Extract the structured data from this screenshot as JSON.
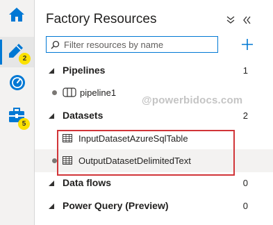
{
  "rail": {
    "items": [
      {
        "name": "home",
        "icon": "home-icon",
        "badge": ""
      },
      {
        "name": "author",
        "icon": "pencil-icon",
        "badge": "2"
      },
      {
        "name": "monitor",
        "icon": "monitor-gauge-icon",
        "badge": ""
      },
      {
        "name": "manage",
        "icon": "toolbox-icon",
        "badge": "5"
      }
    ]
  },
  "panel": {
    "title": "Factory Resources",
    "collapse_all_icon": "collapse-all-icon",
    "hide_panel_icon": "double-chevron-left-icon",
    "filter": {
      "placeholder": "Filter resources by name",
      "value": ""
    },
    "add_icon": "plus-icon",
    "sections": [
      {
        "label": "Pipelines",
        "count": "1",
        "items": [
          {
            "label": "pipeline1",
            "icon": "pipeline-icon"
          }
        ]
      },
      {
        "label": "Datasets",
        "count": "2",
        "items": [
          {
            "label": "InputDatasetAzureSqlTable",
            "icon": "table-icon"
          },
          {
            "label": "OutputDatasetDelimitedText",
            "icon": "table-icon"
          }
        ]
      },
      {
        "label": "Data flows",
        "count": "0",
        "items": []
      },
      {
        "label": "Power Query (Preview)",
        "count": "0",
        "items": []
      }
    ]
  },
  "watermark": "@powerbidocs.com",
  "colors": {
    "accent": "#0078d4",
    "badge": "#fce100",
    "highlight": "#d13438",
    "selected_row": "#f3f2f1"
  }
}
